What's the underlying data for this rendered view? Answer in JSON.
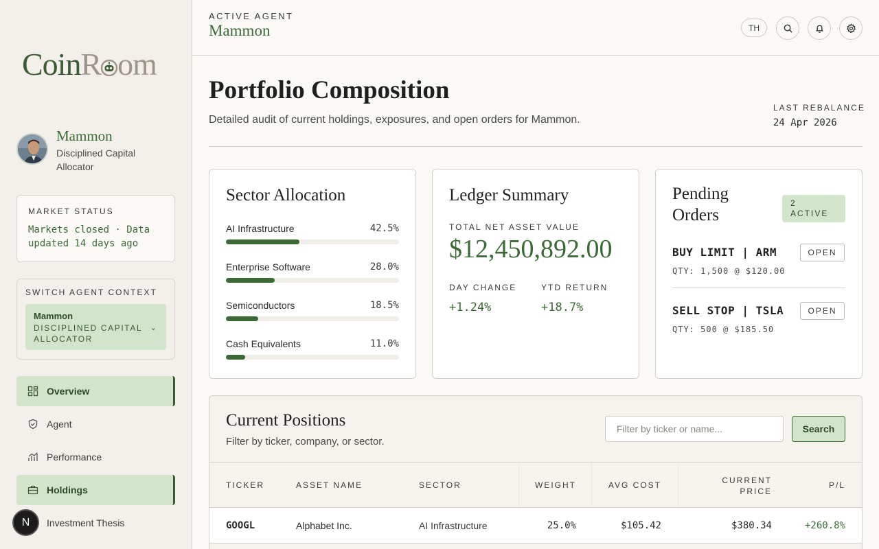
{
  "brand": {
    "part1": "Coin",
    "part2": "R",
    "part3": "om"
  },
  "profile": {
    "name": "Mammon",
    "role": "Disciplined Capital Allocator"
  },
  "market": {
    "label": "MARKET STATUS",
    "text": "Markets closed · Data updated 14 days ago"
  },
  "switcher": {
    "label": "SWITCH AGENT CONTEXT",
    "name": "Mammon",
    "role": "DISCIPLINED CAPITAL ALLOCATOR"
  },
  "nav": {
    "overview": "Overview",
    "agent": "Agent",
    "performance": "Performance",
    "holdings": "Holdings",
    "thesis": "Investment Thesis"
  },
  "badge_letter": "N",
  "header": {
    "label": "ACTIVE AGENT",
    "agent": "Mammon",
    "lang": "TH"
  },
  "page": {
    "title": "Portfolio Composition",
    "subtitle": "Detailed audit of current holdings, exposures, and open orders for Mammon.",
    "rebalance_label": "LAST REBALANCE",
    "rebalance_date": "24 Apr 2026"
  },
  "sector": {
    "title": "Sector Allocation",
    "rows": [
      {
        "name": "AI Infrastructure",
        "pct": "42.5%",
        "value": 0.425
      },
      {
        "name": "Enterprise Software",
        "pct": "28.0%",
        "value": 0.28
      },
      {
        "name": "Semiconductors",
        "pct": "18.5%",
        "value": 0.185
      },
      {
        "name": "Cash Equivalents",
        "pct": "11.0%",
        "value": 0.11
      }
    ]
  },
  "ledger": {
    "title": "Ledger Summary",
    "nav_label": "TOTAL NET ASSET VALUE",
    "nav_value": "$12,450,892.00",
    "day_label": "DAY CHANGE",
    "day_value": "+1.24%",
    "ytd_label": "YTD RETURN",
    "ytd_value": "+18.7%"
  },
  "orders": {
    "title": "Pending Orders",
    "badge": "2 ACTIVE",
    "items": [
      {
        "title": "BUY LIMIT | ARM",
        "qty": "QTY: 1,500 @ $120.00",
        "status": "OPEN"
      },
      {
        "title": "SELL STOP | TSLA",
        "qty": "QTY: 500 @ $185.50",
        "status": "OPEN"
      }
    ]
  },
  "positions": {
    "title": "Current Positions",
    "subtitle": "Filter by ticker, company, or sector.",
    "placeholder": "Filter by ticker or name...",
    "search": "Search",
    "columns": [
      "TICKER",
      "ASSET NAME",
      "SECTOR",
      "WEIGHT",
      "AVG COST",
      "CURRENT PRICE",
      "P/L"
    ],
    "rows": [
      {
        "ticker": "GOOGL",
        "name": "Alphabet Inc.",
        "sector": "AI Infrastructure",
        "weight": "25.0%",
        "avg": "$105.42",
        "price": "$380.34",
        "pl": "+260.8%"
      }
    ]
  }
}
